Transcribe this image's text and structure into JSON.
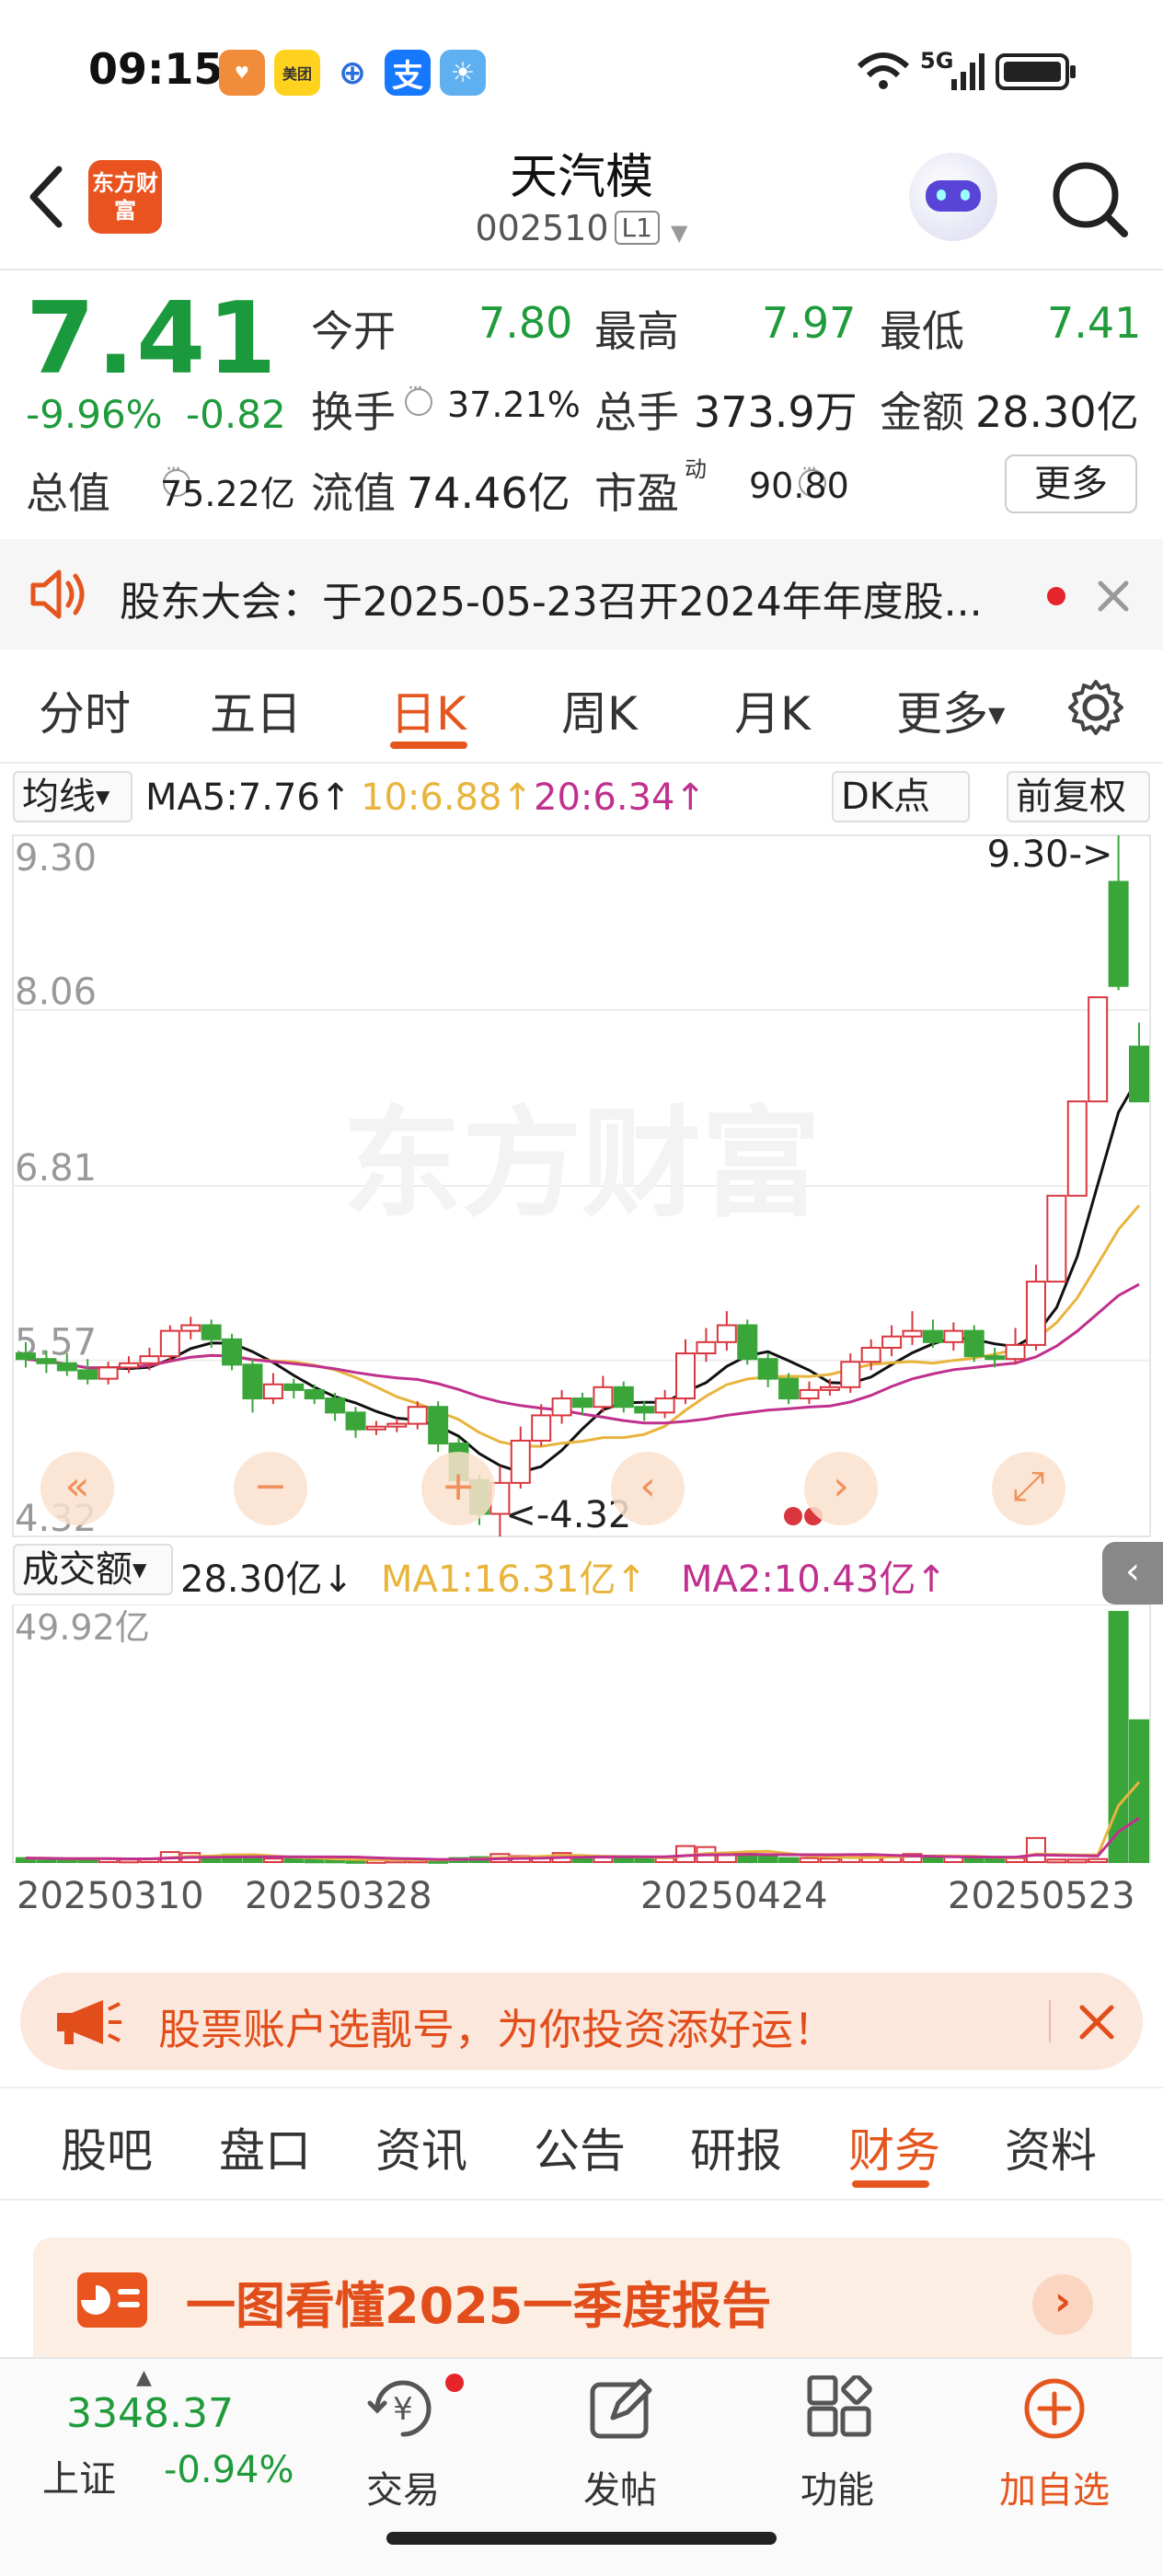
{
  "status_bar": {
    "time": "09:15",
    "apps": [
      "美团"
    ],
    "network": "5G"
  },
  "header": {
    "title": "天汽模",
    "code": "002510",
    "level": "L1",
    "app_logo": "东方财富"
  },
  "quote": {
    "price": "7.41",
    "change_pct": "-9.96%",
    "change": "-0.82",
    "open_label": "今开",
    "open": "7.80",
    "high_label": "最高",
    "high": "7.97",
    "low_label": "最低",
    "low": "7.41",
    "turnover_label": "换手",
    "turnover": "37.21%",
    "volume_label": "总手",
    "volume": "373.9万",
    "amount_label": "金额",
    "amount": "28.30亿",
    "mktcap_label": "总值",
    "mktcap": "75.22亿",
    "float_label": "流值",
    "float": "74.46亿",
    "pe_label": "市盈",
    "pe_sup": "动",
    "pe": "90.80",
    "more": "更多"
  },
  "notice": {
    "text": "股东大会：于2025-05-23召开2024年年度股..."
  },
  "period_tabs": [
    "分时",
    "五日",
    "日K",
    "周K",
    "月K",
    "更多"
  ],
  "active_period": "日K",
  "indicators": {
    "ma_select": "均线",
    "ma5": "MA5:7.76↑",
    "ma10": "10:6.88↑",
    "ma20": "20:6.34↑",
    "dk": "DK点",
    "adjust": "前复权",
    "vol_select": "成交额",
    "vol_val": "28.30亿↓",
    "vol_ma1": "MA1:16.31亿↑",
    "vol_ma2": "MA2:10.43亿↑"
  },
  "chart_data": {
    "type": "candlestick",
    "y_labels": [
      "9.30",
      "8.06",
      "6.81",
      "5.57",
      "4.32"
    ],
    "ylim": [
      4.32,
      9.3
    ],
    "max_marker": "9.30->",
    "min_marker": "<-4.32",
    "vol_max_label": "49.92亿",
    "x_labels": [
      "20250310",
      "20250328",
      "20250424",
      "20250523"
    ],
    "watermark": "东方财富",
    "candles": [
      [
        5.62,
        5.58,
        5.7,
        5.52
      ],
      [
        5.58,
        5.55,
        5.64,
        5.48
      ],
      [
        5.55,
        5.5,
        5.62,
        5.46
      ],
      [
        5.5,
        5.44,
        5.58,
        5.4
      ],
      [
        5.44,
        5.52,
        5.56,
        5.4
      ],
      [
        5.52,
        5.55,
        5.6,
        5.48
      ],
      [
        5.55,
        5.6,
        5.66,
        5.5
      ],
      [
        5.6,
        5.78,
        5.82,
        5.56
      ],
      [
        5.78,
        5.82,
        5.88,
        5.72
      ],
      [
        5.82,
        5.72,
        5.86,
        5.66
      ],
      [
        5.72,
        5.54,
        5.76,
        5.5
      ],
      [
        5.54,
        5.3,
        5.58,
        5.2
      ],
      [
        5.3,
        5.4,
        5.48,
        5.26
      ],
      [
        5.4,
        5.36,
        5.44,
        5.3
      ],
      [
        5.36,
        5.3,
        5.4,
        5.26
      ],
      [
        5.3,
        5.2,
        5.34,
        5.14
      ],
      [
        5.2,
        5.08,
        5.24,
        5.02
      ],
      [
        5.08,
        5.1,
        5.14,
        5.04
      ],
      [
        5.1,
        5.12,
        5.16,
        5.06
      ],
      [
        5.12,
        5.24,
        5.28,
        5.08
      ],
      [
        5.24,
        4.98,
        5.28,
        4.92
      ],
      [
        4.98,
        4.72,
        5.02,
        4.68
      ],
      [
        4.72,
        4.48,
        4.76,
        4.4
      ],
      [
        4.48,
        4.7,
        4.82,
        4.32
      ],
      [
        4.7,
        5.0,
        5.1,
        4.66
      ],
      [
        5.0,
        5.18,
        5.26,
        4.96
      ],
      [
        5.18,
        5.3,
        5.36,
        5.12
      ],
      [
        5.3,
        5.24,
        5.34,
        5.18
      ],
      [
        5.24,
        5.38,
        5.46,
        5.2
      ],
      [
        5.38,
        5.24,
        5.42,
        5.2
      ],
      [
        5.24,
        5.2,
        5.28,
        5.14
      ],
      [
        5.2,
        5.3,
        5.36,
        5.16
      ],
      [
        5.3,
        5.62,
        5.72,
        5.26
      ],
      [
        5.62,
        5.7,
        5.8,
        5.56
      ],
      [
        5.7,
        5.82,
        5.92,
        5.64
      ],
      [
        5.82,
        5.58,
        5.86,
        5.54
      ],
      [
        5.58,
        5.44,
        5.62,
        5.38
      ],
      [
        5.44,
        5.3,
        5.48,
        5.26
      ],
      [
        5.3,
        5.36,
        5.42,
        5.26
      ],
      [
        5.36,
        5.38,
        5.44,
        5.32
      ],
      [
        5.38,
        5.56,
        5.62,
        5.34
      ],
      [
        5.56,
        5.66,
        5.72,
        5.5
      ],
      [
        5.66,
        5.74,
        5.82,
        5.6
      ],
      [
        5.74,
        5.78,
        5.92,
        5.68
      ],
      [
        5.78,
        5.7,
        5.86,
        5.66
      ],
      [
        5.7,
        5.78,
        5.84,
        5.64
      ],
      [
        5.78,
        5.6,
        5.82,
        5.56
      ],
      [
        5.6,
        5.58,
        5.66,
        5.52
      ],
      [
        5.58,
        5.68,
        5.8,
        5.54
      ],
      [
        5.68,
        6.13,
        6.25,
        5.64
      ],
      [
        6.13,
        6.74,
        6.74,
        6.74
      ],
      [
        6.74,
        7.41,
        7.41,
        7.41
      ],
      [
        7.41,
        8.15,
        8.15,
        8.15
      ],
      [
        8.97,
        8.23,
        9.3,
        8.2
      ],
      [
        7.8,
        7.41,
        7.97,
        7.41
      ]
    ],
    "volume": [
      0.8,
      0.7,
      0.6,
      0.6,
      0.7,
      0.5,
      0.6,
      2.0,
      1.8,
      1.2,
      1.5,
      0.9,
      0.7,
      0.6,
      0.5,
      0.5,
      0.4,
      0.4,
      0.5,
      0.5,
      0.4,
      0.8,
      1.0,
      1.6,
      1.2,
      1.0,
      1.8,
      1.0,
      0.9,
      0.8,
      0.6,
      0.8,
      3.2,
      3.0,
      1.6,
      1.8,
      1.2,
      0.8,
      0.8,
      0.7,
      1.0,
      1.2,
      1.4,
      1.6,
      0.9,
      1.0,
      0.8,
      0.6,
      0.8,
      4.8,
      0.5,
      0.5,
      0.6,
      49.92,
      28.3
    ]
  },
  "ad": {
    "text": "股票账户选靓号，为你投资添好运！"
  },
  "bottom_tabs": [
    "股吧",
    "盘口",
    "资讯",
    "公告",
    "研报",
    "财务",
    "资料"
  ],
  "active_bottom_tab": "财务",
  "report": {
    "text": "一图看懂2025一季度报告"
  },
  "bottom_bar": {
    "index_value": "3348.37",
    "index_name": "上证",
    "index_change": "-0.94%",
    "items": [
      "交易",
      "发帖",
      "功能",
      "加自选"
    ]
  }
}
